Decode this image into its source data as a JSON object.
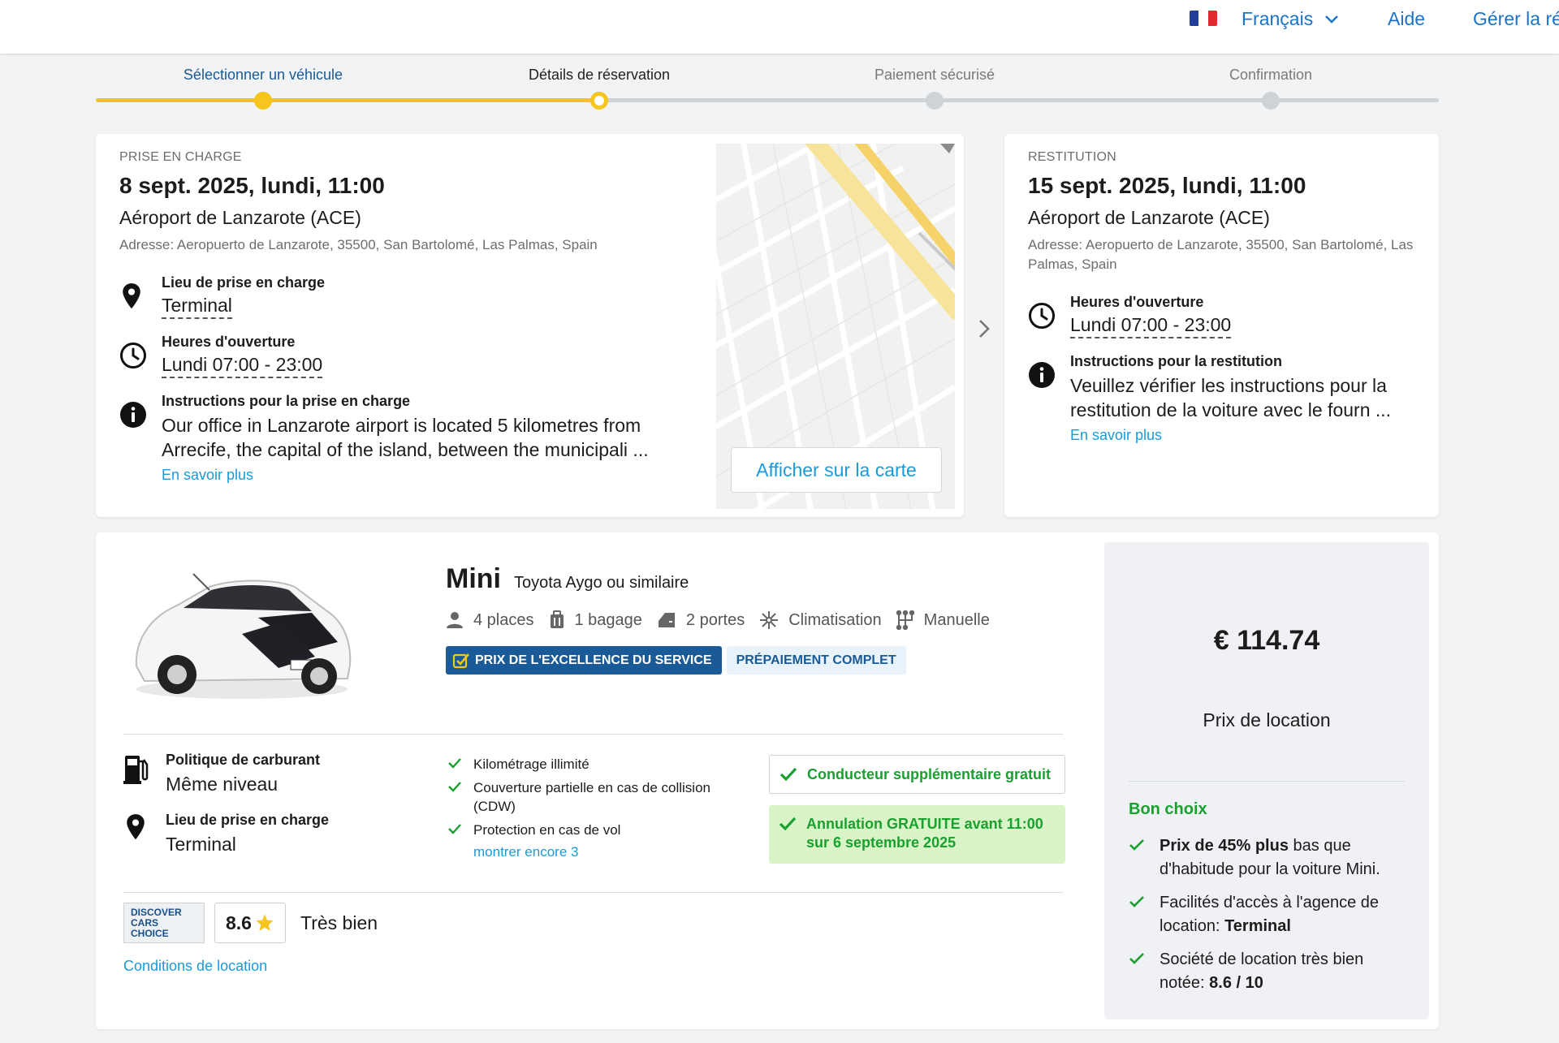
{
  "header": {
    "flag_colors": [
      "#1f3f9a",
      "#ffffff",
      "#e0282e"
    ],
    "language": "Français",
    "help": "Aide",
    "manage": "Gérer la ré"
  },
  "stepper": {
    "progress_fraction": 0.375,
    "steps": [
      {
        "label": "Sélectionner un véhicule",
        "state": "done"
      },
      {
        "label": "Détails de réservation",
        "state": "current"
      },
      {
        "label": "Paiement sécurisé",
        "state": "todo"
      },
      {
        "label": "Confirmation",
        "state": "todo"
      }
    ]
  },
  "pickup": {
    "section_label": "PRISE EN CHARGE",
    "date": "8 sept. 2025, lundi, 11:00",
    "location": "Aéroport de Lanzarote (ACE)",
    "address": "Adresse: Aeropuerto de Lanzarote, 35500, San Bartolomé, Las Palmas, Spain",
    "place_title": "Lieu de prise en charge",
    "place_value": "Terminal",
    "hours_title": "Heures d'ouverture",
    "hours_value": "Lundi 07:00 - 23:00",
    "instructions_title": "Instructions pour la prise en charge",
    "instructions_text": "Our office in Lanzarote airport is located 5 kilometres from Arrecife, the capital of the island, between the municipali ...",
    "more_link": "En savoir plus",
    "map_button": "Afficher sur la carte"
  },
  "return": {
    "section_label": "RESTITUTION",
    "date": "15 sept. 2025, lundi, 11:00",
    "location": "Aéroport de Lanzarote (ACE)",
    "address": "Adresse: Aeropuerto de Lanzarote, 35500, San Bartolomé, Las Palmas, Spain",
    "hours_title": "Heures d'ouverture",
    "hours_value": "Lundi 07:00 - 23:00",
    "instructions_title": "Instructions pour la restitution",
    "instructions_text": "Veuillez vérifier les instructions pour la restitution de la voiture avec le fourn ...",
    "more_link": "En savoir plus"
  },
  "car": {
    "category": "Mini",
    "model": "Toyota Aygo ou similaire",
    "specs": {
      "seats": "4 places",
      "bags": "1 bagage",
      "doors": "2 portes",
      "ac": "Climatisation",
      "transmission": "Manuelle"
    },
    "badge_award": "PRIX DE L'EXCELLENCE DU SERVICE",
    "badge_prepay": "PRÉPAIEMENT COMPLET",
    "fuel_title": "Politique de carburant",
    "fuel_value": "Même niveau",
    "place_title": "Lieu de prise en charge",
    "place_value": "Terminal",
    "included": [
      "Kilométrage illimité",
      "Couverture partielle en cas de collision (CDW)",
      "Protection en cas de vol"
    ],
    "show_more": "montrer encore 3",
    "extra_driver": "Conducteur supplémentaire gratuit",
    "free_cancel": "Annulation GRATUITE avant 11:00 sur 6 septembre 2025",
    "logo_lines": [
      "DISCOVER",
      "CARS",
      "CHOICE"
    ],
    "score": "8.6",
    "score_label": "Très bien",
    "conditions_link": "Conditions de location"
  },
  "price_panel": {
    "price": "€ 114.74",
    "price_label": "Prix de location",
    "good_choice": "Bon choix",
    "r1_bold": "Prix de 45% plus",
    "r1_rest": " bas que d'habitude pour la voiture Mini.",
    "r2_text": "Facilités d'accès à l'agence de location: ",
    "r2_bold": "Terminal",
    "r3_text": "Société de location très bien notée: ",
    "r3_bold": "8.6 / 10"
  },
  "colors": {
    "accent_blue": "#1a73c9",
    "link_blue": "#1a9bd7",
    "progress_yellow": "#f6c51e",
    "success_green": "#19a02f",
    "badge_navy": "#1a5a96"
  }
}
